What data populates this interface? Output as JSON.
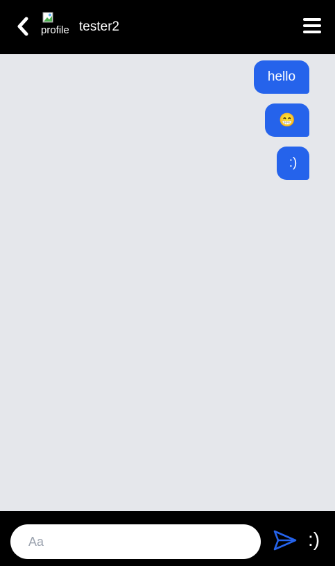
{
  "header": {
    "avatar_alt": "profile",
    "contact_name": "tester2"
  },
  "messages": [
    {
      "text": "hello",
      "from": "me"
    },
    {
      "text": "😁",
      "from": "me"
    },
    {
      "text": ":)",
      "from": "me"
    }
  ],
  "composer": {
    "placeholder": "Aa",
    "emoji_label": ":)"
  },
  "colors": {
    "header_bg": "#000000",
    "bubble_bg": "#2563eb",
    "chat_bg": "#e5e7eb",
    "send_icon": "#2563eb"
  },
  "icons": {
    "back": "chevron-left-icon",
    "menu": "hamburger-menu-icon",
    "send": "send-icon"
  }
}
